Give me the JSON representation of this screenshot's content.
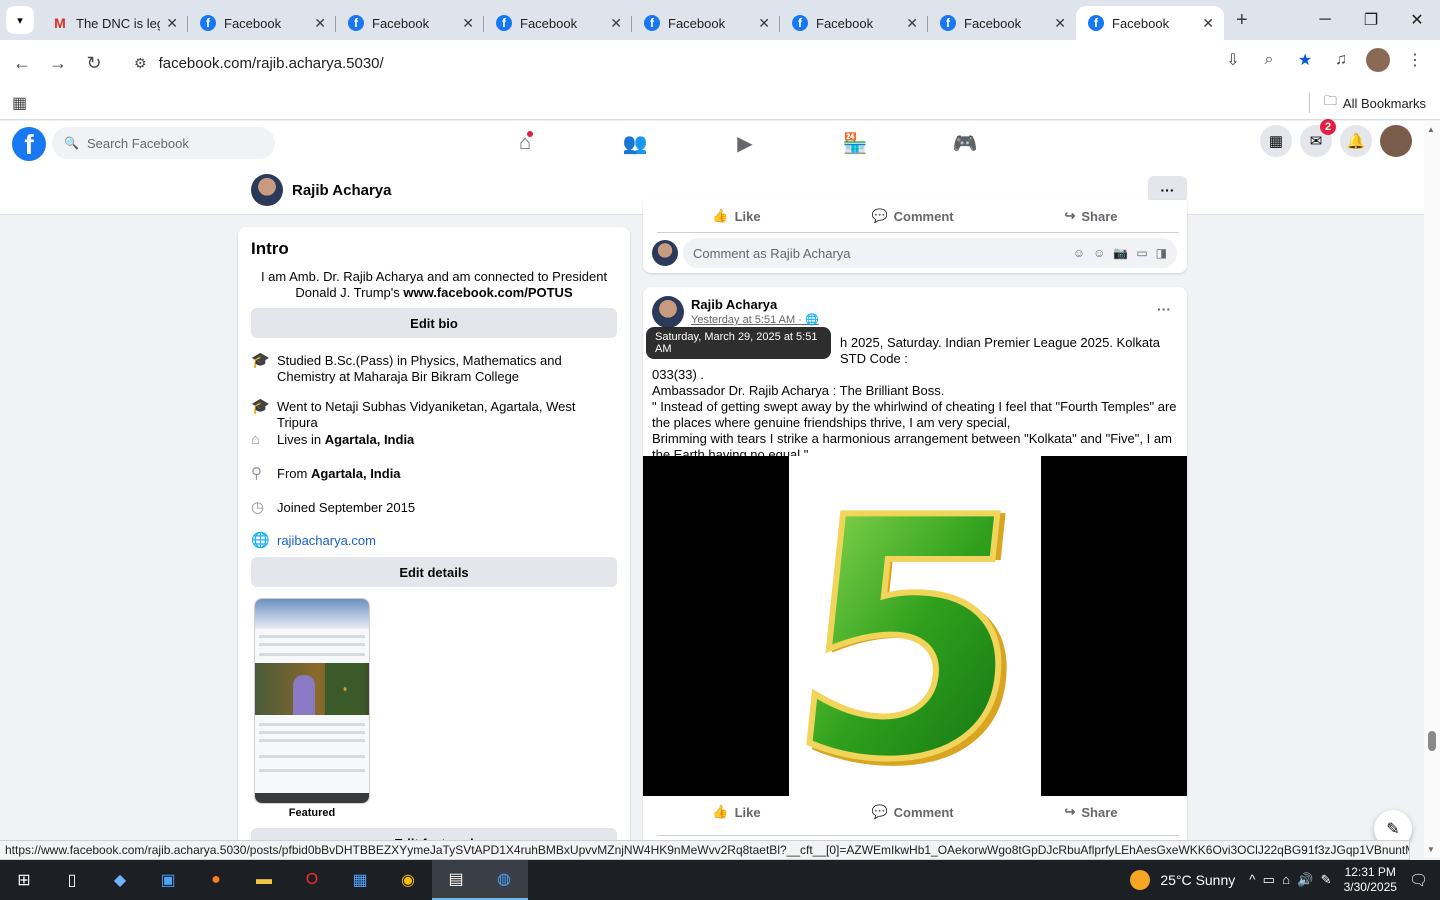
{
  "browser": {
    "tabs": [
      {
        "title": "The DNC is leg",
        "icon": "gmail-icon"
      },
      {
        "title": "Facebook",
        "icon": "facebook-icon"
      },
      {
        "title": "Facebook",
        "icon": "facebook-icon"
      },
      {
        "title": "Facebook",
        "icon": "facebook-icon"
      },
      {
        "title": "Facebook",
        "icon": "facebook-icon"
      },
      {
        "title": "Facebook",
        "icon": "facebook-icon"
      },
      {
        "title": "Facebook",
        "icon": "facebook-icon"
      },
      {
        "title": "Facebook",
        "icon": "facebook-icon",
        "active": true
      }
    ],
    "url": "facebook.com/rajib.acharya.5030/",
    "all_bookmarks": "All Bookmarks",
    "status_url": "https://www.facebook.com/rajib.acharya.5030/posts/pfbid0bBvDHTBBEZXYymeJaTySVtAPD1X4ruhBMBxUpvvMZnjNW4HK9nMeWvv2Rq8taetBl?__cft__[0]=AZWEmIkwHb1_OAekorwWgo8tGpDJcRbuAflprfyLEhAesGxeWKK6Ovi3OClJ22qBG91f3zJGqp1VBnuntMYBJCT..."
  },
  "fb": {
    "search_placeholder": "Search Facebook",
    "messenger_badge": "2",
    "profile_name": "Rajib Acharya"
  },
  "intro": {
    "title": "Intro",
    "bio_text": "I am Amb. Dr. Rajib Acharya and am connected to President Donald J. Trump's ",
    "bio_link": "www.facebook.com/POTUS",
    "edit_bio": "Edit bio",
    "studied": "Studied B.Sc.(Pass) in Physics, Mathematics and Chemistry at Maharaja Bir Bikram College",
    "went_to": "Went to Netaji Subhas Vidyaniketan, Agartala, West Tripura",
    "lives_prefix": "Lives in ",
    "lives_place": "Agartala, India",
    "from_prefix": "From ",
    "from_place": "Agartala, India",
    "joined": "Joined September 2015",
    "website": "rajibacharya.com",
    "edit_details": "Edit details",
    "featured_label": "Featured",
    "edit_featured": "Edit featured"
  },
  "prev_post": {
    "like": "Like",
    "comment": "Comment",
    "share": "Share",
    "comment_placeholder": "Comment as Rajib Acharya"
  },
  "post": {
    "author": "Rajib Acharya",
    "timestamp": "Yesterday at 5:51 AM",
    "tooltip": "Saturday, March 29, 2025 at 5:51 AM",
    "line1_tail": "h 2025, Saturday. Indian Premier League 2025. Kolkata STD Code :",
    "line2": "033(33) .",
    "line3": "Ambassador Dr. Rajib Acharya : The Brilliant Boss.",
    "line4": "\" Instead of getting swept away by the whirlwind of cheating I feel that \"Fourth Temples\" are the places where genuine friendships thrive, I am very special,",
    "line5": "Brimming with tears I strike a harmonious arrangement between \"Kolkata\" and \"Five\", I am the Earth having no equal.\"",
    "image_digit": "5",
    "like": "Like",
    "comment": "Comment",
    "share": "Share"
  },
  "taskbar": {
    "weather_temp": "25°C",
    "weather_cond": "Sunny",
    "time": "12:31 PM",
    "date": "3/30/2025"
  }
}
